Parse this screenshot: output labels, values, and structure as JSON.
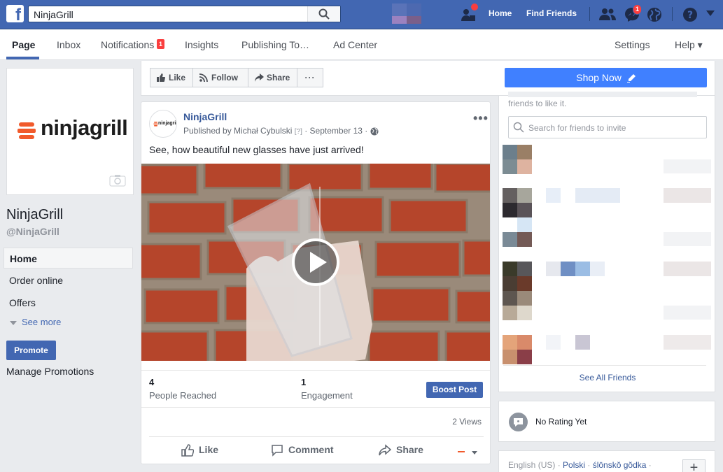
{
  "topbar": {
    "search_value": "NinjaGrill",
    "nav_home": "Home",
    "nav_find_friends": "Find Friends",
    "messages_badge": "1"
  },
  "page_nav": {
    "tabs": [
      {
        "label": "Page"
      },
      {
        "label": "Inbox"
      },
      {
        "label": "Notifications"
      },
      {
        "label": "Insights"
      },
      {
        "label": "Publishing To…"
      },
      {
        "label": "Ad Center"
      }
    ],
    "notifications_badge": "1",
    "settings": "Settings",
    "help": "Help ▾"
  },
  "sidebar": {
    "logo_text": "ninjagrill",
    "page_name": "NinjaGrill",
    "page_handle": "@NinjaGrill",
    "items": [
      {
        "label": "Home"
      },
      {
        "label": "Order online"
      },
      {
        "label": "Offers"
      }
    ],
    "see_more": "See more",
    "promote": "Promote",
    "manage_promotions": "Manage Promotions"
  },
  "action_bar": {
    "like": "Like",
    "follow": "Follow",
    "share": "Share",
    "more": "···",
    "shop_now": "Shop Now"
  },
  "post": {
    "author": "NinjaGrill",
    "avatar_text": "ninjagrill",
    "published_by": "Published by Michał Cybulski",
    "help_marker": "[?]",
    "date": "September 13",
    "text": "See, how beautiful new glasses have just arrived!",
    "stat1_value": "4",
    "stat1_label": "People Reached",
    "stat2_value": "1",
    "stat2_label": "Engagement",
    "boost": "Boost Post",
    "views": "2 Views",
    "actions": {
      "like": "Like",
      "comment": "Comment",
      "share": "Share"
    }
  },
  "friends": {
    "invite_text": "friends to like it.",
    "search_placeholder": "Search for friends to invite",
    "see_all": "See All Friends"
  },
  "rating": {
    "text": "No Rating Yet"
  },
  "languages": {
    "current": "English (US)",
    "others": [
      "Polski",
      "ślōnskŏ gŏdka"
    ],
    "plus": "+"
  },
  "colors": {
    "brand": "#4267b2",
    "accent": "#4080ff",
    "badge": "#fa3e3e",
    "logo_orange": "#f15a2b"
  }
}
